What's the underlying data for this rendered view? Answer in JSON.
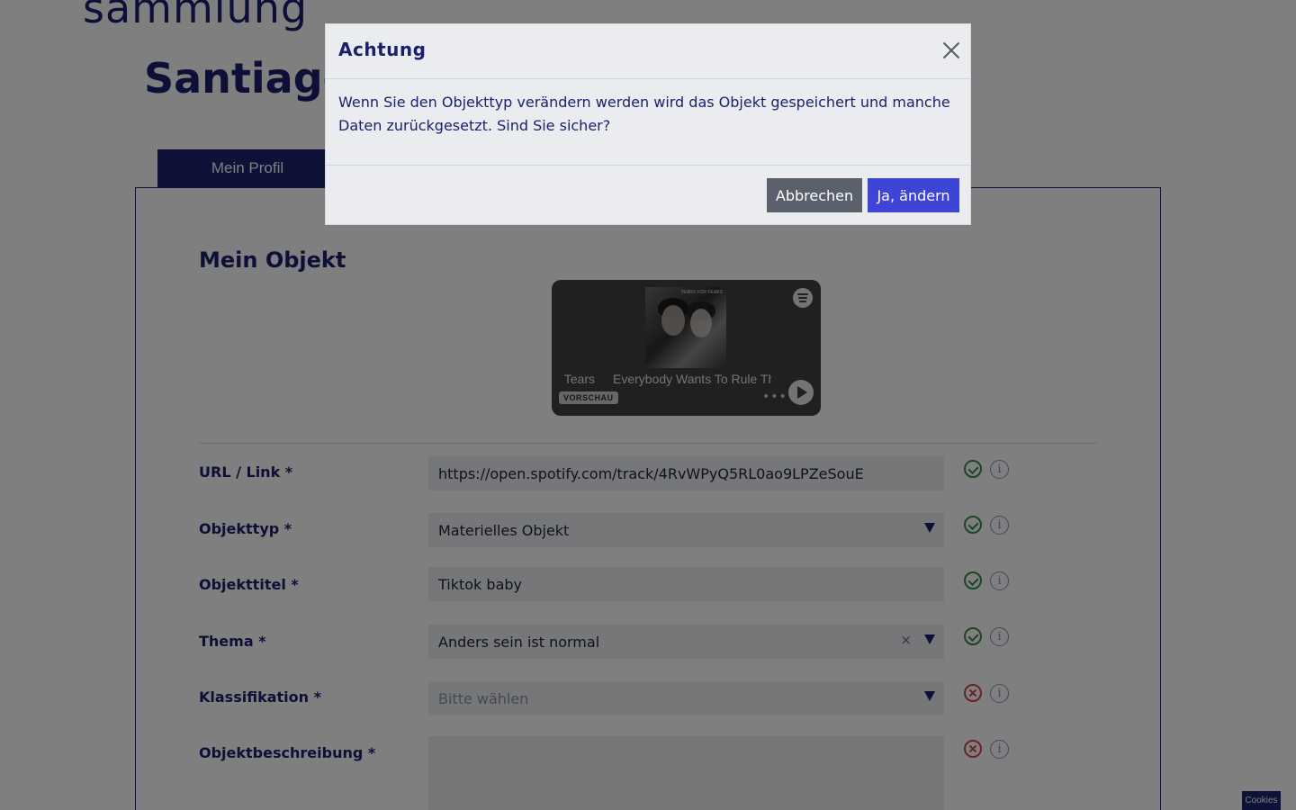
{
  "header": {
    "brand_fragment": "sammlung",
    "user_name_fragment": "Santiago"
  },
  "tabs": {
    "active_label": "Mein Profil"
  },
  "section": {
    "title": "Mein Objekt"
  },
  "embed": {
    "artist_fragment": "Tears",
    "track_title": "Everybody Wants To Rule The World",
    "preview_label": "VORSCHAU",
    "more_label": "•••",
    "cover_text": "TEARS FOR FEARS"
  },
  "form": {
    "url": {
      "label": "URL / Link *",
      "value": "https://open.spotify.com/track/4RvWPyQ5RL0ao9LPZeSouE",
      "status": "valid"
    },
    "object_type": {
      "label": "Objekttyp *",
      "value": "Materielles Objekt",
      "status": "valid"
    },
    "object_title": {
      "label": "Objekttitel *",
      "value": "Tiktok baby",
      "status": "valid"
    },
    "theme": {
      "label": "Thema *",
      "value": "Anders sein ist normal",
      "clear_label": "×",
      "status": "valid"
    },
    "classification": {
      "label": "Klassifikation *",
      "placeholder": "Bitte wählen",
      "status": "invalid"
    },
    "description": {
      "label": "Objektbeschreibung *",
      "value": "",
      "status": "invalid"
    },
    "info_glyph": "i"
  },
  "cookies": {
    "label": "Cookies"
  },
  "modal": {
    "title": "Achtung",
    "message": "Wenn Sie den Objekttyp verändern werden wird das Objekt gespeichert und manche Daten zurückgesetzt. Sind Sie sicher?",
    "cancel_label": "Abbrechen",
    "confirm_label": "Ja, ändern"
  },
  "colors": {
    "brand_navy": "#1d2370",
    "confirm_blue": "#3d44d6",
    "cancel_gray": "#5b616c",
    "valid_green": "#3a8a4a",
    "invalid_red": "#d0454c"
  }
}
